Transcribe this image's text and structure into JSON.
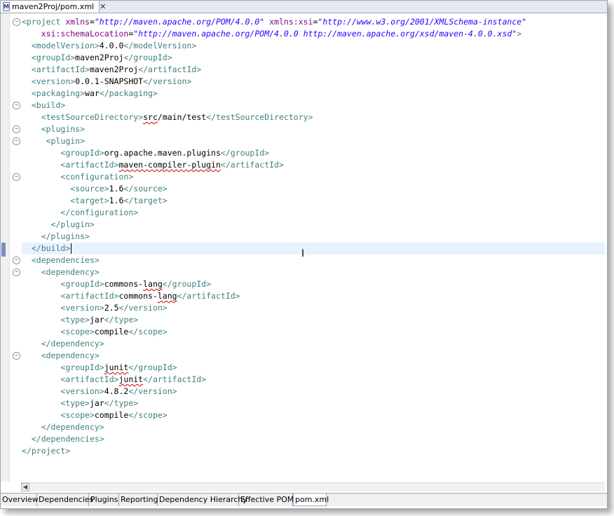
{
  "editor_tab": {
    "title": "maven2Proj/pom.xml",
    "file_icon": "maven-file-icon",
    "close_icon": "close-icon"
  },
  "lines": [
    {
      "fold": true,
      "segs": [
        [
          "tg",
          "<project "
        ],
        [
          "an",
          "xmlns"
        ],
        [
          "tx",
          "="
        ],
        [
          "av",
          "\"http://maven.apache.org/POM/4.0.0\""
        ],
        [
          "tx",
          " "
        ],
        [
          "an",
          "xmlns:xsi"
        ],
        [
          "tx",
          "="
        ],
        [
          "av",
          "\"http://www.w3.org/2001/XMLSchema-instance\""
        ]
      ]
    },
    {
      "fold": false,
      "segs": [
        [
          "tx",
          "    "
        ],
        [
          "an",
          "xsi:schemaLocation"
        ],
        [
          "tx",
          "="
        ],
        [
          "av",
          "\"http://maven.apache.org/POM/4.0.0 http://maven.apache.org/xsd/maven-4.0.0.xsd\""
        ],
        [
          "tg",
          ">"
        ]
      ]
    },
    {
      "fold": false,
      "segs": [
        [
          "tx",
          "  "
        ],
        [
          "tg",
          "<modelVersion>"
        ],
        [
          "tx",
          "4.0.0"
        ],
        [
          "tg",
          "</modelVersion>"
        ]
      ]
    },
    {
      "fold": false,
      "segs": [
        [
          "tx",
          "  "
        ],
        [
          "tg",
          "<groupId>"
        ],
        [
          "tx",
          "maven2Proj"
        ],
        [
          "tg",
          "</groupId>"
        ]
      ]
    },
    {
      "fold": false,
      "segs": [
        [
          "tx",
          "  "
        ],
        [
          "tg",
          "<artifactId>"
        ],
        [
          "tx",
          "maven2Proj"
        ],
        [
          "tg",
          "</artifactId>"
        ]
      ]
    },
    {
      "fold": false,
      "segs": [
        [
          "tx",
          "  "
        ],
        [
          "tg",
          "<version>"
        ],
        [
          "tx",
          "0.0.1-SNAPSHOT"
        ],
        [
          "tg",
          "</version>"
        ]
      ]
    },
    {
      "fold": false,
      "segs": [
        [
          "tx",
          "  "
        ],
        [
          "tg",
          "<packaging>"
        ],
        [
          "tx",
          "war"
        ],
        [
          "tg",
          "</packaging>"
        ]
      ]
    },
    {
      "fold": true,
      "segs": [
        [
          "tx",
          "  "
        ],
        [
          "tg",
          "<build>"
        ]
      ]
    },
    {
      "fold": false,
      "segs": [
        [
          "tx",
          "    "
        ],
        [
          "tg",
          "<testSourceDirectory>"
        ],
        [
          "sq",
          "src"
        ],
        [
          "tx",
          "/main/test"
        ],
        [
          "tg",
          "</testSourceDirectory>"
        ]
      ]
    },
    {
      "fold": true,
      "segs": [
        [
          "tx",
          "    "
        ],
        [
          "tg",
          "<plugins>"
        ]
      ]
    },
    {
      "fold": true,
      "segs": [
        [
          "tx",
          "     "
        ],
        [
          "tg",
          "<plugin>"
        ]
      ]
    },
    {
      "fold": false,
      "segs": [
        [
          "tx",
          "        "
        ],
        [
          "tg",
          "<groupId>"
        ],
        [
          "tx",
          "org.apache.maven.plugins"
        ],
        [
          "tg",
          "</groupId>"
        ]
      ]
    },
    {
      "fold": false,
      "segs": [
        [
          "tx",
          "        "
        ],
        [
          "tg",
          "<artifactId>"
        ],
        [
          "sq",
          "maven-compiler-plugin"
        ],
        [
          "tg",
          "</artifactId>"
        ]
      ]
    },
    {
      "fold": true,
      "segs": [
        [
          "tx",
          "        "
        ],
        [
          "tg",
          "<configuration>"
        ]
      ]
    },
    {
      "fold": false,
      "segs": [
        [
          "tx",
          "          "
        ],
        [
          "tg",
          "<source>"
        ],
        [
          "tx",
          "1.6"
        ],
        [
          "tg",
          "</source>"
        ]
      ]
    },
    {
      "fold": false,
      "segs": [
        [
          "tx",
          "          "
        ],
        [
          "tg",
          "<target>"
        ],
        [
          "tx",
          "1.6"
        ],
        [
          "tg",
          "</target>"
        ]
      ]
    },
    {
      "fold": false,
      "segs": [
        [
          "tx",
          "        "
        ],
        [
          "tg",
          "</configuration>"
        ]
      ]
    },
    {
      "fold": false,
      "segs": [
        [
          "tx",
          "      "
        ],
        [
          "tg",
          "</plugin>"
        ]
      ]
    },
    {
      "fold": false,
      "segs": [
        [
          "tx",
          "    "
        ],
        [
          "tg",
          "</plugins>"
        ]
      ]
    },
    {
      "fold": false,
      "segs": [
        [
          "tx",
          "  "
        ],
        [
          "tg",
          "</build>"
        ]
      ]
    },
    {
      "fold": true,
      "segs": [
        [
          "tx",
          "  "
        ],
        [
          "tg",
          "<dependencies>"
        ]
      ]
    },
    {
      "fold": true,
      "segs": [
        [
          "tx",
          "    "
        ],
        [
          "tg",
          "<dependency>"
        ]
      ]
    },
    {
      "fold": false,
      "segs": [
        [
          "tx",
          "        "
        ],
        [
          "tg",
          "<groupId>"
        ],
        [
          "tx",
          "commons-"
        ],
        [
          "sq",
          "lang"
        ],
        [
          "tg",
          "</groupId>"
        ]
      ]
    },
    {
      "fold": false,
      "segs": [
        [
          "tx",
          "        "
        ],
        [
          "tg",
          "<artifactId>"
        ],
        [
          "tx",
          "commons-"
        ],
        [
          "sq",
          "lang"
        ],
        [
          "tg",
          "</artifactId>"
        ]
      ]
    },
    {
      "fold": false,
      "segs": [
        [
          "tx",
          "        "
        ],
        [
          "tg",
          "<version>"
        ],
        [
          "tx",
          "2.5"
        ],
        [
          "tg",
          "</version>"
        ]
      ]
    },
    {
      "fold": false,
      "segs": [
        [
          "tx",
          "        "
        ],
        [
          "tg",
          "<type>"
        ],
        [
          "tx",
          "jar"
        ],
        [
          "tg",
          "</type>"
        ]
      ]
    },
    {
      "fold": false,
      "segs": [
        [
          "tx",
          "        "
        ],
        [
          "tg",
          "<scope>"
        ],
        [
          "tx",
          "compile"
        ],
        [
          "tg",
          "</scope>"
        ]
      ]
    },
    {
      "fold": false,
      "segs": [
        [
          "tx",
          "    "
        ],
        [
          "tg",
          "</dependency>"
        ]
      ]
    },
    {
      "fold": true,
      "segs": [
        [
          "tx",
          "    "
        ],
        [
          "tg",
          "<dependency>"
        ]
      ]
    },
    {
      "fold": false,
      "segs": [
        [
          "tx",
          "        "
        ],
        [
          "tg",
          "<groupId>"
        ],
        [
          "sq",
          "junit"
        ],
        [
          "tg",
          "</groupId>"
        ]
      ]
    },
    {
      "fold": false,
      "segs": [
        [
          "tx",
          "        "
        ],
        [
          "tg",
          "<artifactId>"
        ],
        [
          "sq",
          "junit"
        ],
        [
          "tg",
          "</artifactId>"
        ]
      ]
    },
    {
      "fold": false,
      "segs": [
        [
          "tx",
          "        "
        ],
        [
          "tg",
          "<version>"
        ],
        [
          "tx",
          "4.8.2"
        ],
        [
          "tg",
          "</version>"
        ]
      ]
    },
    {
      "fold": false,
      "segs": [
        [
          "tx",
          "        "
        ],
        [
          "tg",
          "<type>"
        ],
        [
          "tx",
          "jar"
        ],
        [
          "tg",
          "</type>"
        ]
      ]
    },
    {
      "fold": false,
      "segs": [
        [
          "tx",
          "        "
        ],
        [
          "tg",
          "<scope>"
        ],
        [
          "tx",
          "compile"
        ],
        [
          "tg",
          "</scope>"
        ]
      ]
    },
    {
      "fold": false,
      "segs": [
        [
          "tx",
          "    "
        ],
        [
          "tg",
          "</dependency>"
        ]
      ]
    },
    {
      "fold": false,
      "segs": [
        [
          "tx",
          "  "
        ],
        [
          "tg",
          "</dependencies>"
        ]
      ]
    },
    {
      "fold": false,
      "segs": [
        [
          "tg",
          "</project>"
        ]
      ]
    }
  ],
  "current_line": 19,
  "bottom_tabs": [
    {
      "label": "Overview"
    },
    {
      "label": "Dependencies"
    },
    {
      "label": "Plugins"
    },
    {
      "label": "Reporting"
    },
    {
      "label": "Dependency Hierarchy"
    },
    {
      "label": "Effective POM"
    },
    {
      "label": "pom.xml",
      "active": true
    }
  ],
  "colors": {
    "tag": "#3f7f7f",
    "attr_name": "#7f007f",
    "attr_value": "#2a00ff",
    "current_line": "#e8f2fe"
  }
}
